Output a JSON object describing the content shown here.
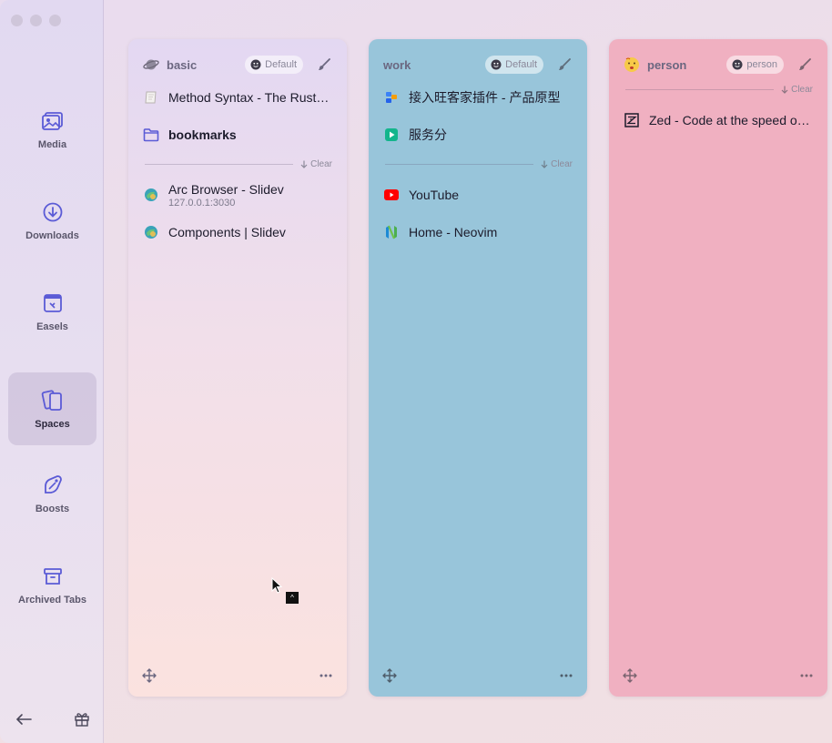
{
  "sidebar": {
    "items": [
      {
        "label": "Media",
        "icon": "media-icon"
      },
      {
        "label": "Downloads",
        "icon": "download-icon"
      },
      {
        "label": "Easels",
        "icon": "easel-icon"
      },
      {
        "label": "Spaces",
        "icon": "spaces-icon",
        "active": true
      },
      {
        "label": "Boosts",
        "icon": "boost-icon"
      },
      {
        "label": "Archived Tabs",
        "icon": "archive-icon"
      }
    ]
  },
  "spaces": [
    {
      "name": "basic",
      "badge": "Default",
      "icon": "planet-icon",
      "pinned": [
        {
          "title": "Method Syntax - The Rust Programming Language"
        },
        {
          "title": "bookmarks",
          "folder": true
        }
      ],
      "clear_label": "Clear",
      "tabs": [
        {
          "title": "Arc Browser - Slidev",
          "subtitle": "127.0.0.1:3030"
        },
        {
          "title": "Components | Slidev"
        }
      ]
    },
    {
      "name": "work",
      "badge": "Default",
      "pinned": [
        {
          "title": "接入旺客家插件 - 产品原型"
        },
        {
          "title": "服务分"
        }
      ],
      "clear_label": "Clear",
      "tabs": [
        {
          "title": "YouTube"
        },
        {
          "title": "Home - Neovim"
        }
      ]
    },
    {
      "name": "person",
      "badge": "person",
      "icon": "emoji-face-icon",
      "clear_label": "Clear",
      "tabs": [
        {
          "title": "Zed - Code at the speed of thought"
        }
      ]
    }
  ],
  "colors": {
    "basic_top": "#e3d8f2",
    "basic_bottom": "#fbe2df",
    "work": "#98c5da",
    "person": "#f0b0c1",
    "accent": "#5b5bd6"
  },
  "tooltip": "^"
}
